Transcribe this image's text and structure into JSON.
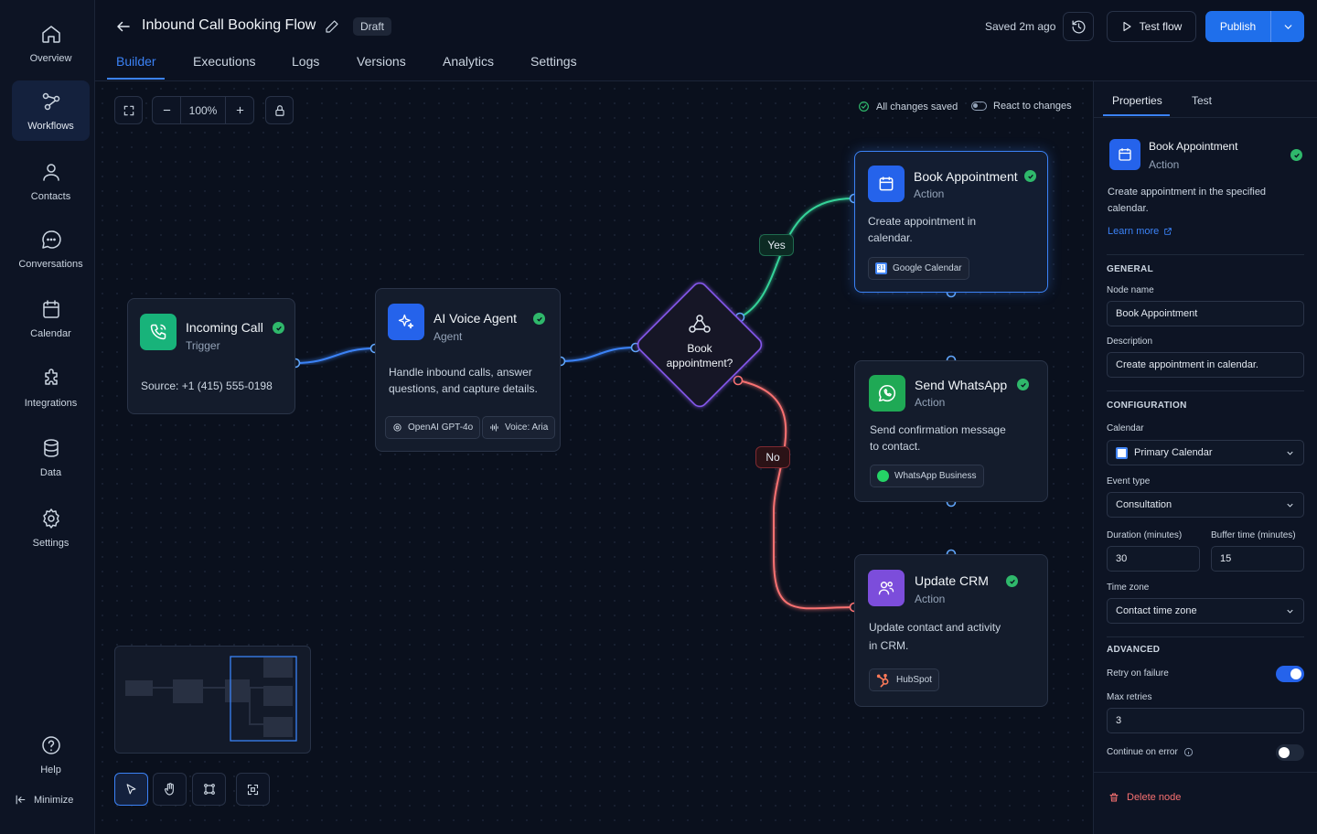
{
  "nav": {
    "items": [
      {
        "label": "Overview",
        "icon": "home-icon"
      },
      {
        "label": "Workflows",
        "icon": "workflow-icon",
        "active": true
      },
      {
        "label": "Contacts",
        "icon": "user-icon"
      },
      {
        "label": "Conversations",
        "icon": "chat-icon"
      },
      {
        "label": "Calendar",
        "icon": "calendar-icon"
      },
      {
        "label": "Integrations",
        "icon": "puzzle-icon"
      },
      {
        "label": "Data",
        "icon": "database-icon"
      },
      {
        "label": "Settings",
        "icon": "gear-icon"
      }
    ],
    "help": "Help",
    "minimize": "Minimize"
  },
  "header": {
    "title": "Inbound Call Booking Flow",
    "status": "Draft",
    "saved": "Saved 2m ago",
    "test_flow": "Test flow",
    "publish": "Publish",
    "tabs": [
      "Builder",
      "Executions",
      "Logs",
      "Versions",
      "Analytics",
      "Settings"
    ],
    "active_tab": "Builder"
  },
  "canvas": {
    "zoom": "100%",
    "all_saved": "All changes saved",
    "react_changes": "React to changes",
    "nodes": {
      "incoming": {
        "title": "Incoming Call",
        "subtitle": "Trigger",
        "desc": "Source: +1 (415) 555-0198"
      },
      "agent": {
        "title": "AI Voice Agent",
        "subtitle": "Agent",
        "desc1": "Handle inbound calls, answer",
        "desc2": "questions, and capture details.",
        "chip1": "OpenAI GPT-4o",
        "chip2": "Voice: Aria"
      },
      "decision": {
        "line1": "Book",
        "line2": "appointment?"
      },
      "book": {
        "title": "Book Appointment",
        "subtitle": "Action",
        "desc1": "Create appointment in",
        "desc2": "calendar.",
        "chip": "Google Calendar"
      },
      "whatsapp": {
        "title": "Send WhatsApp",
        "subtitle": "Action",
        "desc1": "Send confirmation message",
        "desc2": "to contact.",
        "chip": "WhatsApp Business"
      },
      "crm": {
        "title": "Update CRM",
        "subtitle": "Action",
        "desc1": "Update contact and activity",
        "desc2": "in CRM.",
        "chip": "HubSpot"
      }
    },
    "edges": {
      "yes": "Yes",
      "no": "No"
    }
  },
  "panel": {
    "tabs": [
      "Properties",
      "Test"
    ],
    "node_title": "Book Appointment",
    "node_sub": "Action",
    "desc1": "Create appointment in the specified",
    "desc2": "calendar.",
    "learn_more": "Learn more",
    "general": "GENERAL",
    "node_name_label": "Node name",
    "node_name": "Book Appointment",
    "description_label": "Description",
    "description": "Create appointment in calendar.",
    "configuration": "CONFIGURATION",
    "calendar_label": "Calendar",
    "calendar": "Primary Calendar",
    "event_type_label": "Event type",
    "event_type": "Consultation",
    "duration_label": "Duration (minutes)",
    "duration": "30",
    "buffer_label": "Buffer time (minutes)",
    "buffer": "15",
    "timezone_label": "Time zone",
    "timezone": "Contact time zone",
    "advanced": "ADVANCED",
    "retry_label": "Retry on failure",
    "retry_on": true,
    "max_retries_label": "Max retries",
    "max_retries": "3",
    "continue_label": "Continue on error",
    "continue_on": false,
    "delete": "Delete node"
  },
  "colors": {
    "accent": "#3b82f6",
    "success": "#2fb86b",
    "danger": "#f87171",
    "yes_edge": "#34d399",
    "no_edge": "#f87171"
  }
}
